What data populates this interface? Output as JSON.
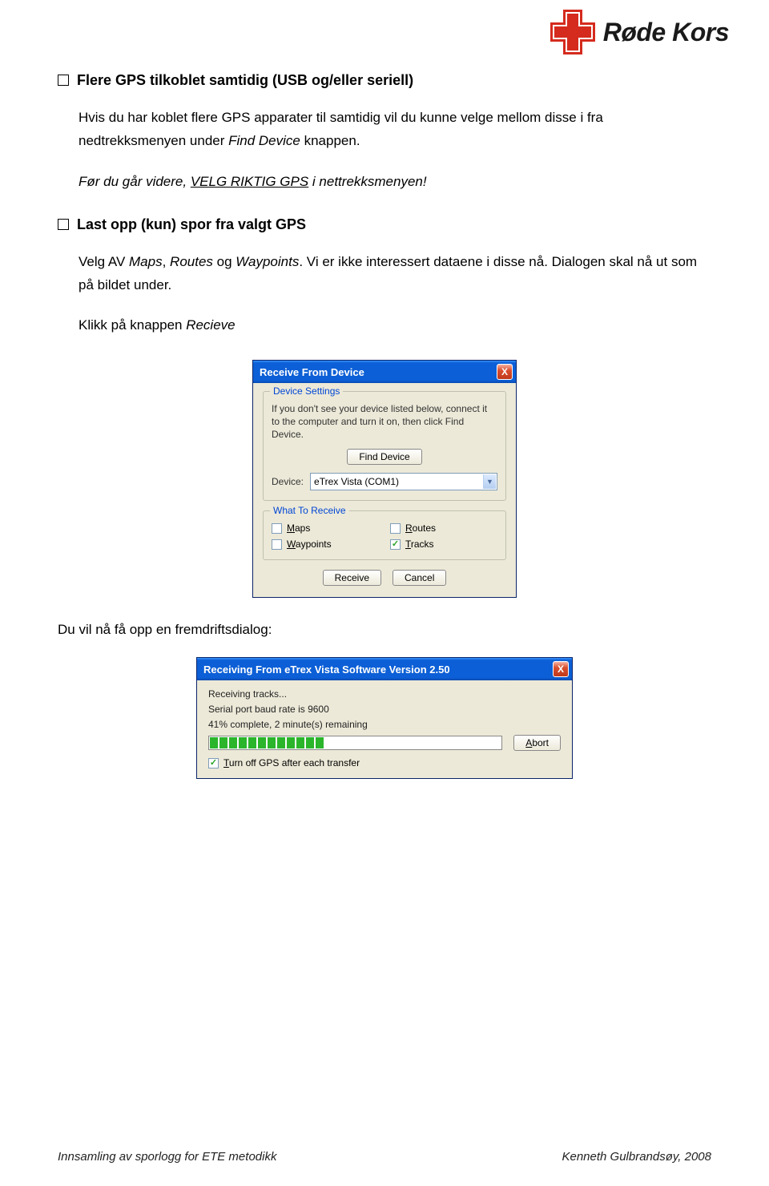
{
  "header": {
    "logo_text": "Røde Kors"
  },
  "section1": {
    "heading": "Flere GPS tilkoblet samtidig (USB og/eller seriell)",
    "para": "Hvis du har koblet flere GPS apparater til samtidig vil du kunne velge mellom disse i fra nedtrekksmenyen under ",
    "para_em1": "Find Device",
    "para_after": " knappen.",
    "note_before": "Før du går videre, ",
    "note_underline": "VELG RIKTIG GPS",
    "note_after": " i nettrekksmenyen!"
  },
  "section2": {
    "heading": "Last opp (kun) spor fra valgt GPS",
    "para_a": "Velg AV ",
    "em1": "Maps",
    "comma1": ", ",
    "em2": "Routes",
    "mid": " og ",
    "em3": "Waypoints",
    "para_b": ". Vi er ikke interessert dataene i disse nå. Dialogen skal nå ut som på bildet under.",
    "click_line_a": "Klikk på knappen ",
    "click_line_em": "Recieve"
  },
  "dialog1": {
    "title": "Receive From Device",
    "group1_label": "Device Settings",
    "group1_text": "If you don't see your device listed below, connect it to the computer and turn it on, then click Find Device.",
    "find_device_btn": "Find Device",
    "device_label": "Device:",
    "device_value": "eTrex Vista (COM1)",
    "group2_label": "What To Receive",
    "chk_maps_u": "M",
    "chk_maps_rest": "aps",
    "chk_routes_u": "R",
    "chk_routes_rest": "outes",
    "chk_waypoints_u": "W",
    "chk_waypoints_rest": "aypoints",
    "chk_tracks_u": "T",
    "chk_tracks_rest": "racks",
    "checked_tracks": "✓",
    "receive_btn": "Receive",
    "cancel_btn": "Cancel",
    "close_x": "X"
  },
  "after_dialog1": "Du vil nå få opp en fremdriftsdialog:",
  "dialog2": {
    "title": "Receiving From eTrex Vista Software Version 2.50",
    "line1": "Receiving tracks...",
    "line2": "Serial port baud rate is 9600",
    "line3": "41% complete, 2 minute(s) remaining",
    "abort_u": "A",
    "abort_rest": "bort",
    "turnoff_u": "T",
    "turnoff_rest": "urn off GPS after each transfer",
    "checked": "✓",
    "close_x": "X"
  },
  "footer": {
    "left": "Innsamling av sporlogg for ETE metodikk",
    "right": "Kenneth Gulbrandsøy, 2008"
  }
}
